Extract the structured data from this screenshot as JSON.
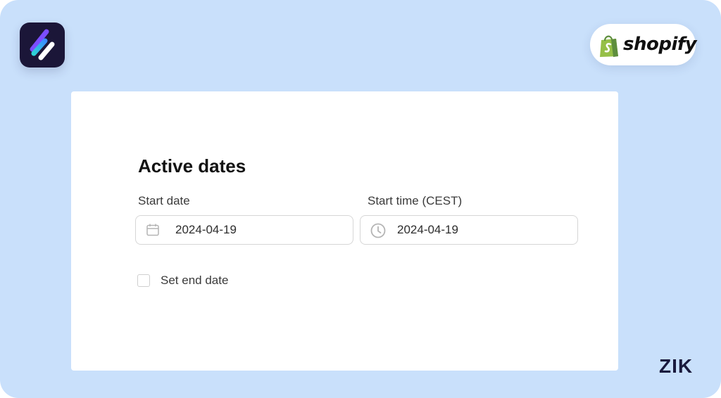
{
  "form": {
    "title": "Active dates",
    "start_date": {
      "label": "Start date",
      "value": "2024-04-19",
      "icon": "calendar-icon"
    },
    "start_time": {
      "label": "Start time (CEST)",
      "value": "2024-04-19",
      "icon": "clock-icon"
    },
    "end_date": {
      "label": "Set end date",
      "checked": false
    }
  },
  "badges": {
    "shopify": "shopify",
    "brand": "ZIK"
  },
  "colors": {
    "background": "#c9e0fb",
    "card": "#ffffff",
    "app_logo_bg": "#1b1638",
    "shopify_green": "#95bf47",
    "brand_text": "#1a1a3e"
  }
}
